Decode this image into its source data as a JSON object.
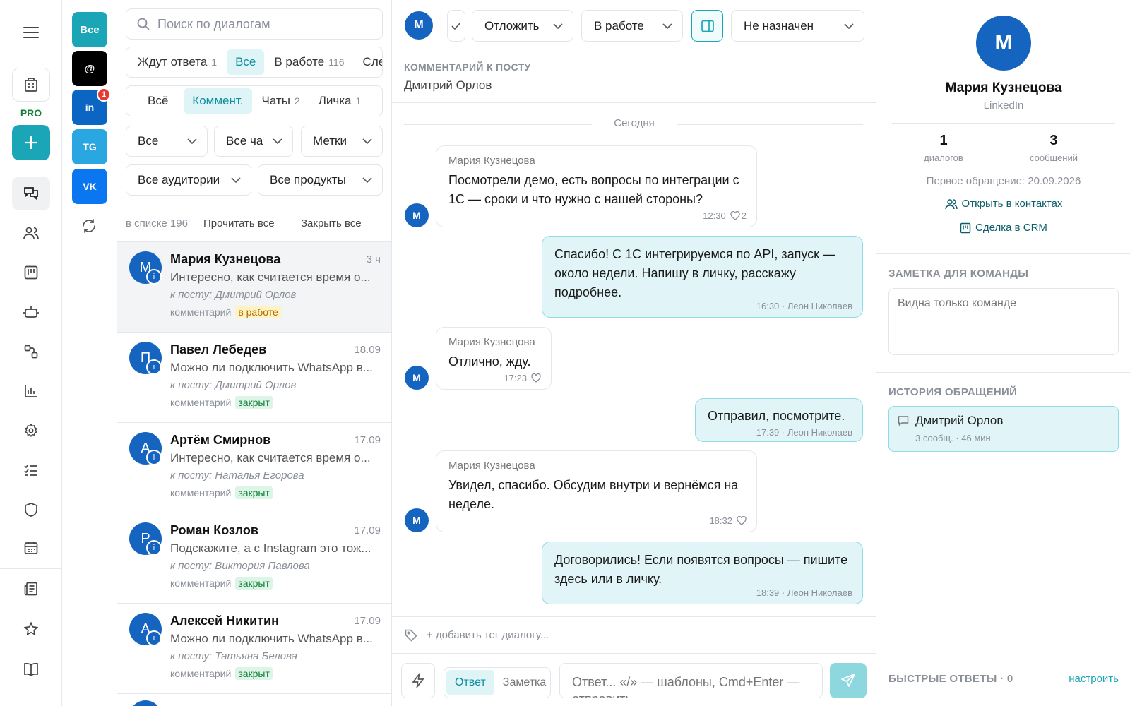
{
  "app": {
    "pro_label": "PRO"
  },
  "channels": [
    {
      "label": "Все",
      "color": "#1aa6b7"
    },
    {
      "label": "@",
      "color": "#000000"
    },
    {
      "label": "in",
      "color": "#0a66c2",
      "badge": "1"
    },
    {
      "label": "TG",
      "color": "#2aa6e0"
    },
    {
      "label": "VK",
      "color": "#0a77f0"
    }
  ],
  "search": {
    "placeholder": "Поиск по диалогам"
  },
  "status_tabs": [
    {
      "label": "Ждут ответа",
      "count": "1"
    },
    {
      "label": "Все",
      "count": ""
    },
    {
      "label": "В работе",
      "count": "116"
    },
    {
      "label": "Сле",
      "count": ""
    }
  ],
  "type_tabs": [
    {
      "label": "Всё",
      "count": ""
    },
    {
      "label": "Коммент.",
      "count": ""
    },
    {
      "label": "Чаты",
      "count": "2"
    },
    {
      "label": "Личка",
      "count": "1"
    }
  ],
  "filters": {
    "all": "Все",
    "all_chats": "Все ча",
    "tags": "Метки",
    "audiences": "Все аудитории",
    "products": "Все продукты"
  },
  "list_actions": {
    "count_text": "в списке 196",
    "read_all": "Прочитать все",
    "close_all": "Закрыть все"
  },
  "conversations": [
    {
      "initial": "М",
      "name": "Мария Кузнецова",
      "time": "3 ч",
      "preview": "Интересно, как считается время о...",
      "post": "к посту: Дмитрий Орлов",
      "type": "комментарий",
      "status": "в работе",
      "status_kind": "work"
    },
    {
      "initial": "П",
      "name": "Павел Лебедев",
      "time": "18.09",
      "preview": "Можно ли подключить WhatsApp в...",
      "post": "к посту: Дмитрий Орлов",
      "type": "комментарий",
      "status": "закрыт",
      "status_kind": "closed"
    },
    {
      "initial": "А",
      "name": "Артём Смирнов",
      "time": "17.09",
      "preview": "Интересно, как считается время о...",
      "post": "к посту: Наталья Егорова",
      "type": "комментарий",
      "status": "закрыт",
      "status_kind": "closed"
    },
    {
      "initial": "Р",
      "name": "Роман Козлов",
      "time": "17.09",
      "preview": "Подскажите, а с Instagram это тож...",
      "post": "к посту: Виктория Павлова",
      "type": "комментарий",
      "status": "закрыт",
      "status_kind": "closed"
    },
    {
      "initial": "А",
      "name": "Алексей Никитин",
      "time": "17.09",
      "preview": "Можно ли подключить WhatsApp в...",
      "post": "к посту: Татьяна Белова",
      "type": "комментарий",
      "status": "закрыт",
      "status_kind": "closed"
    }
  ],
  "chat": {
    "avatar_initial": "М",
    "postpone": "Отложить",
    "status": "В работе",
    "assignee": "Не назначен",
    "context_label": "КОММЕНТАРИЙ К ПОСТУ",
    "context_value": "Дмитрий Орлов",
    "date_divider": "Сегодня",
    "messages": [
      {
        "dir": "in",
        "author": "Мария Кузнецова",
        "text": "Посмотрели демо, есть вопросы по интеграции с 1С — сроки и что нужно с нашей стороны?",
        "time": "12:30",
        "likes": "2"
      },
      {
        "dir": "out",
        "text": "Спасибо! С 1С интегрируемся по API, запуск — около недели. Напишу в личку, расскажу подробнее.",
        "meta": "16:30 · Леон Николаев"
      },
      {
        "dir": "in",
        "author": "Мария Кузнецова",
        "text": "Отлично, жду.",
        "time": "17:23",
        "likes": ""
      },
      {
        "dir": "out",
        "text": "Отправил, посмотрите.",
        "meta": "17:39 · Леон Николаев"
      },
      {
        "dir": "in",
        "author": "Мария Кузнецова",
        "text": "Увидел, спасибо. Обсудим внутри и вернёмся на неделе.",
        "time": "18:32",
        "likes": ""
      },
      {
        "dir": "out",
        "text": "Договорились! Если появятся вопросы — пишите здесь или в личку.",
        "meta": "18:39 · Леон Николаев"
      }
    ],
    "add_tag": "+ добавить тег диалогу...",
    "mode_reply": "Ответ",
    "mode_note": "Заметка",
    "input_placeholder": "Ответ... «/» — шаблоны, Cmd+Enter — отправить"
  },
  "profile": {
    "initial": "М",
    "name": "Мария Кузнецова",
    "network": "LinkedIn",
    "dialogs_count": "1",
    "dialogs_label": "диалогов",
    "messages_count": "3",
    "messages_label": "сообщений",
    "first_contact": "Первое обращение: 20.09.2026",
    "open_contacts": "Открыть в контактах",
    "crm_deal": "Сделка в CRM",
    "note_title": "ЗАМЕТКА ДЛЯ КОМАНДЫ",
    "note_placeholder": "Видна только команде",
    "history_title": "ИСТОРИЯ ОБРАЩЕНИЙ",
    "history": [
      {
        "title": "Дмитрий Орлов",
        "meta": "3 сообщ. · 46 мин"
      }
    ],
    "quick_replies": "БЫСТРЫЕ ОТВЕТЫ · 0",
    "configure": "настроить"
  },
  "colors": {
    "accent": "#1aa6b7",
    "brand_blue": "#1565c0"
  }
}
